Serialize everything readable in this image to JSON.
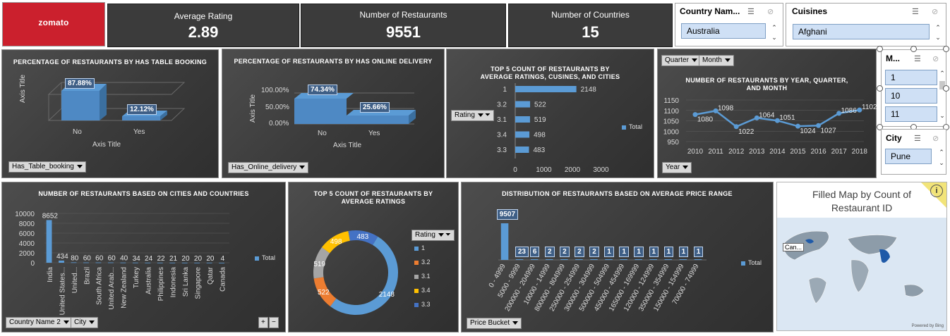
{
  "brand": {
    "logo_text": "zomato",
    "color": "#cb202d"
  },
  "kpis": {
    "avg_rating": {
      "label": "Average Rating",
      "value": "2.89"
    },
    "restaurants": {
      "label": "Number of Restaurants",
      "value": "9551"
    },
    "countries": {
      "label": "Number of Countries",
      "value": "15"
    }
  },
  "slicers": {
    "country": {
      "title": "Country Nam...",
      "item": "Australia"
    },
    "cuisines": {
      "title": "Cuisines",
      "item": "Afghani"
    },
    "month": {
      "title": "M...",
      "items": [
        "1",
        "10",
        "11"
      ]
    },
    "city": {
      "title": "City",
      "item": "Pune"
    }
  },
  "charts": {
    "table_booking": {
      "title": "PERCENTAGE OF RESTAURANTS BY HAS TABLE BOOKING",
      "ylabel": "Axis Title",
      "xlabel": "Axis Title",
      "categories": [
        "No",
        "Yes"
      ],
      "labels": [
        "87.88%",
        "12.12%"
      ],
      "filter": "Has_Table_booking"
    },
    "online_delivery": {
      "title": "PERCENTAGE OF RESTAURANTS BY HAS ONLINE DELIVERY",
      "ylabel": "Axis Title",
      "xlabel": "Axis Title",
      "categories": [
        "No",
        "Yes"
      ],
      "labels": [
        "74.34%",
        "25.66%"
      ],
      "yticks": [
        "100.00%",
        "50.00%",
        "0.00%"
      ],
      "filter": "Has_Online_delivery"
    },
    "top5_cuisines": {
      "title_line1": "TOP 5 COUNT OF RESTAURANTS BY",
      "title_line2": "AVERAGE RATINGS, CUSINES, AND CITIES",
      "categories": [
        "1",
        "3.2",
        "3.1",
        "3.4",
        "3.3"
      ],
      "values": [
        "2148",
        "522",
        "519",
        "498",
        "483"
      ],
      "xticks": [
        "0",
        "1000",
        "2000",
        "3000"
      ],
      "legend": "Total",
      "filter": "Rating"
    },
    "by_year": {
      "title_line1": "NUMBER OF RESTAURANTS BY YEAR, QUARTER,",
      "title_line2": "AND MONTH",
      "years": [
        "2010",
        "2011",
        "2012",
        "2013",
        "2014",
        "2015",
        "2016",
        "2017",
        "2018"
      ],
      "values": [
        "1080",
        "1098",
        "1022",
        "1064",
        "1051",
        "1024",
        "1027",
        "1086",
        "1102"
      ],
      "yticks": [
        "1150",
        "1100",
        "1050",
        "1000",
        "950"
      ],
      "filters": [
        "Quarter",
        "Month",
        "Year"
      ]
    },
    "by_city": {
      "title": "NUMBER OF RESTAURANTS BASED ON CITIES AND COUNTRIES",
      "countries": [
        "India",
        "United States...",
        "United...",
        "Brazil",
        "South Africa",
        "United Arab...",
        "New Zealand",
        "Turkey",
        "Australia",
        "Philippines",
        "Indonesia",
        "Sri Lanka",
        "Singapore",
        "Qatar",
        "Canada"
      ],
      "values": [
        "8652",
        "434",
        "80",
        "60",
        "60",
        "60",
        "40",
        "34",
        "24",
        "22",
        "21",
        "20",
        "20",
        "20",
        "4"
      ],
      "yticks": [
        "10000",
        "8000",
        "6000",
        "4000",
        "2000",
        "0"
      ],
      "legend": "Total",
      "filters": [
        "Country Name 2",
        "City"
      ],
      "zoom": [
        "+",
        "−"
      ]
    },
    "top5_ratings": {
      "title_line1": "TOP 5 COUNT OF RESTAURANTS BY",
      "title_line2": "AVERAGE RATINGS",
      "labels": [
        "2148",
        "522",
        "519",
        "498",
        "483"
      ],
      "legend_title": "Rating",
      "legend": [
        "1",
        "3.2",
        "3.1",
        "3.4",
        "3.3"
      ]
    },
    "price_range": {
      "title": "DISTRIBUTION OF RESTAURANTS BASED ON AVERAGE PRICE RANGE",
      "buckets": [
        "0 - 4999",
        "5000 - 9999",
        "200000 - 204999",
        "10000 - 14999",
        "800000 - 804999",
        "250000 - 254999",
        "300000 - 304999",
        "500000 - 504999",
        "450000 - 454999",
        "165000 - 169999",
        "120000 - 124999",
        "350000 - 354999",
        "150000 - 154999",
        "70000 - 74999"
      ],
      "values": [
        "9507",
        "23",
        "6",
        "2",
        "2",
        "2",
        "2",
        "1",
        "1",
        "1",
        "1",
        "1",
        "1",
        "1"
      ],
      "legend": "Total",
      "filter": "Price Bucket"
    },
    "map": {
      "title": "Filled Map by Count of Restaurant ID",
      "callout": "Can...",
      "attribution": "Powered by Bing",
      "info": "i"
    }
  },
  "chart_data": [
    {
      "type": "bar",
      "title": "PERCENTAGE OF RESTAURANTS BY HAS TABLE BOOKING",
      "categories": [
        "No",
        "Yes"
      ],
      "values": [
        87.88,
        12.12
      ],
      "xlabel": "Axis Title",
      "ylabel": "Axis Title"
    },
    {
      "type": "area",
      "title": "PERCENTAGE OF RESTAURANTS BY HAS ONLINE DELIVERY",
      "categories": [
        "No",
        "Yes"
      ],
      "values": [
        74.34,
        25.66
      ],
      "ylim": [
        0,
        100
      ],
      "xlabel": "Axis Title",
      "ylabel": "Axis Title"
    },
    {
      "type": "bar",
      "title": "TOP 5 COUNT OF RESTAURANTS BY AVERAGE RATINGS, CUSINES, AND CITIES",
      "categories": [
        "1",
        "3.2",
        "3.1",
        "3.4",
        "3.3"
      ],
      "values": [
        2148,
        522,
        519,
        498,
        483
      ],
      "xlim": [
        0,
        3000
      ],
      "orientation": "horizontal"
    },
    {
      "type": "line",
      "title": "NUMBER OF RESTAURANTS BY YEAR, QUARTER, AND MONTH",
      "x": [
        2010,
        2011,
        2012,
        2013,
        2014,
        2015,
        2016,
        2017,
        2018
      ],
      "values": [
        1080,
        1098,
        1022,
        1064,
        1051,
        1024,
        1027,
        1086,
        1102
      ],
      "ylim": [
        950,
        1150
      ]
    },
    {
      "type": "bar",
      "title": "NUMBER OF RESTAURANTS BASED ON CITIES AND COUNTRIES",
      "categories": [
        "India",
        "United States...",
        "United...",
        "Brazil",
        "South Africa",
        "United Arab...",
        "New Zealand",
        "Turkey",
        "Australia",
        "Philippines",
        "Indonesia",
        "Sri Lanka",
        "Singapore",
        "Qatar",
        "Canada"
      ],
      "values": [
        8652,
        434,
        80,
        60,
        60,
        60,
        40,
        34,
        24,
        22,
        21,
        20,
        20,
        20,
        4
      ],
      "ylim": [
        0,
        10000
      ]
    },
    {
      "type": "pie",
      "title": "TOP 5 COUNT OF RESTAURANTS BY AVERAGE RATINGS",
      "categories": [
        "1",
        "3.2",
        "3.1",
        "3.4",
        "3.3"
      ],
      "values": [
        2148,
        522,
        519,
        498,
        483
      ],
      "colors": [
        "#5b9bd5",
        "#ed7d31",
        "#a5a5a5",
        "#ffc000",
        "#4472c4"
      ]
    },
    {
      "type": "bar",
      "title": "DISTRIBUTION OF RESTAURANTS BASED ON AVERAGE PRICE RANGE",
      "categories": [
        "0 - 4999",
        "5000 - 9999",
        "200000 - 204999",
        "10000 - 14999",
        "800000 - 804999",
        "250000 - 254999",
        "300000 - 304999",
        "500000 - 504999",
        "450000 - 454999",
        "165000 - 169999",
        "120000 - 124999",
        "350000 - 354999",
        "150000 - 154999",
        "70000 - 74999"
      ],
      "values": [
        9507,
        23,
        6,
        2,
        2,
        2,
        2,
        1,
        1,
        1,
        1,
        1,
        1,
        1
      ]
    }
  ],
  "colors": {
    "accent": "#5b9bd5",
    "brand": "#cb202d",
    "panel": "#3b3b3b"
  }
}
